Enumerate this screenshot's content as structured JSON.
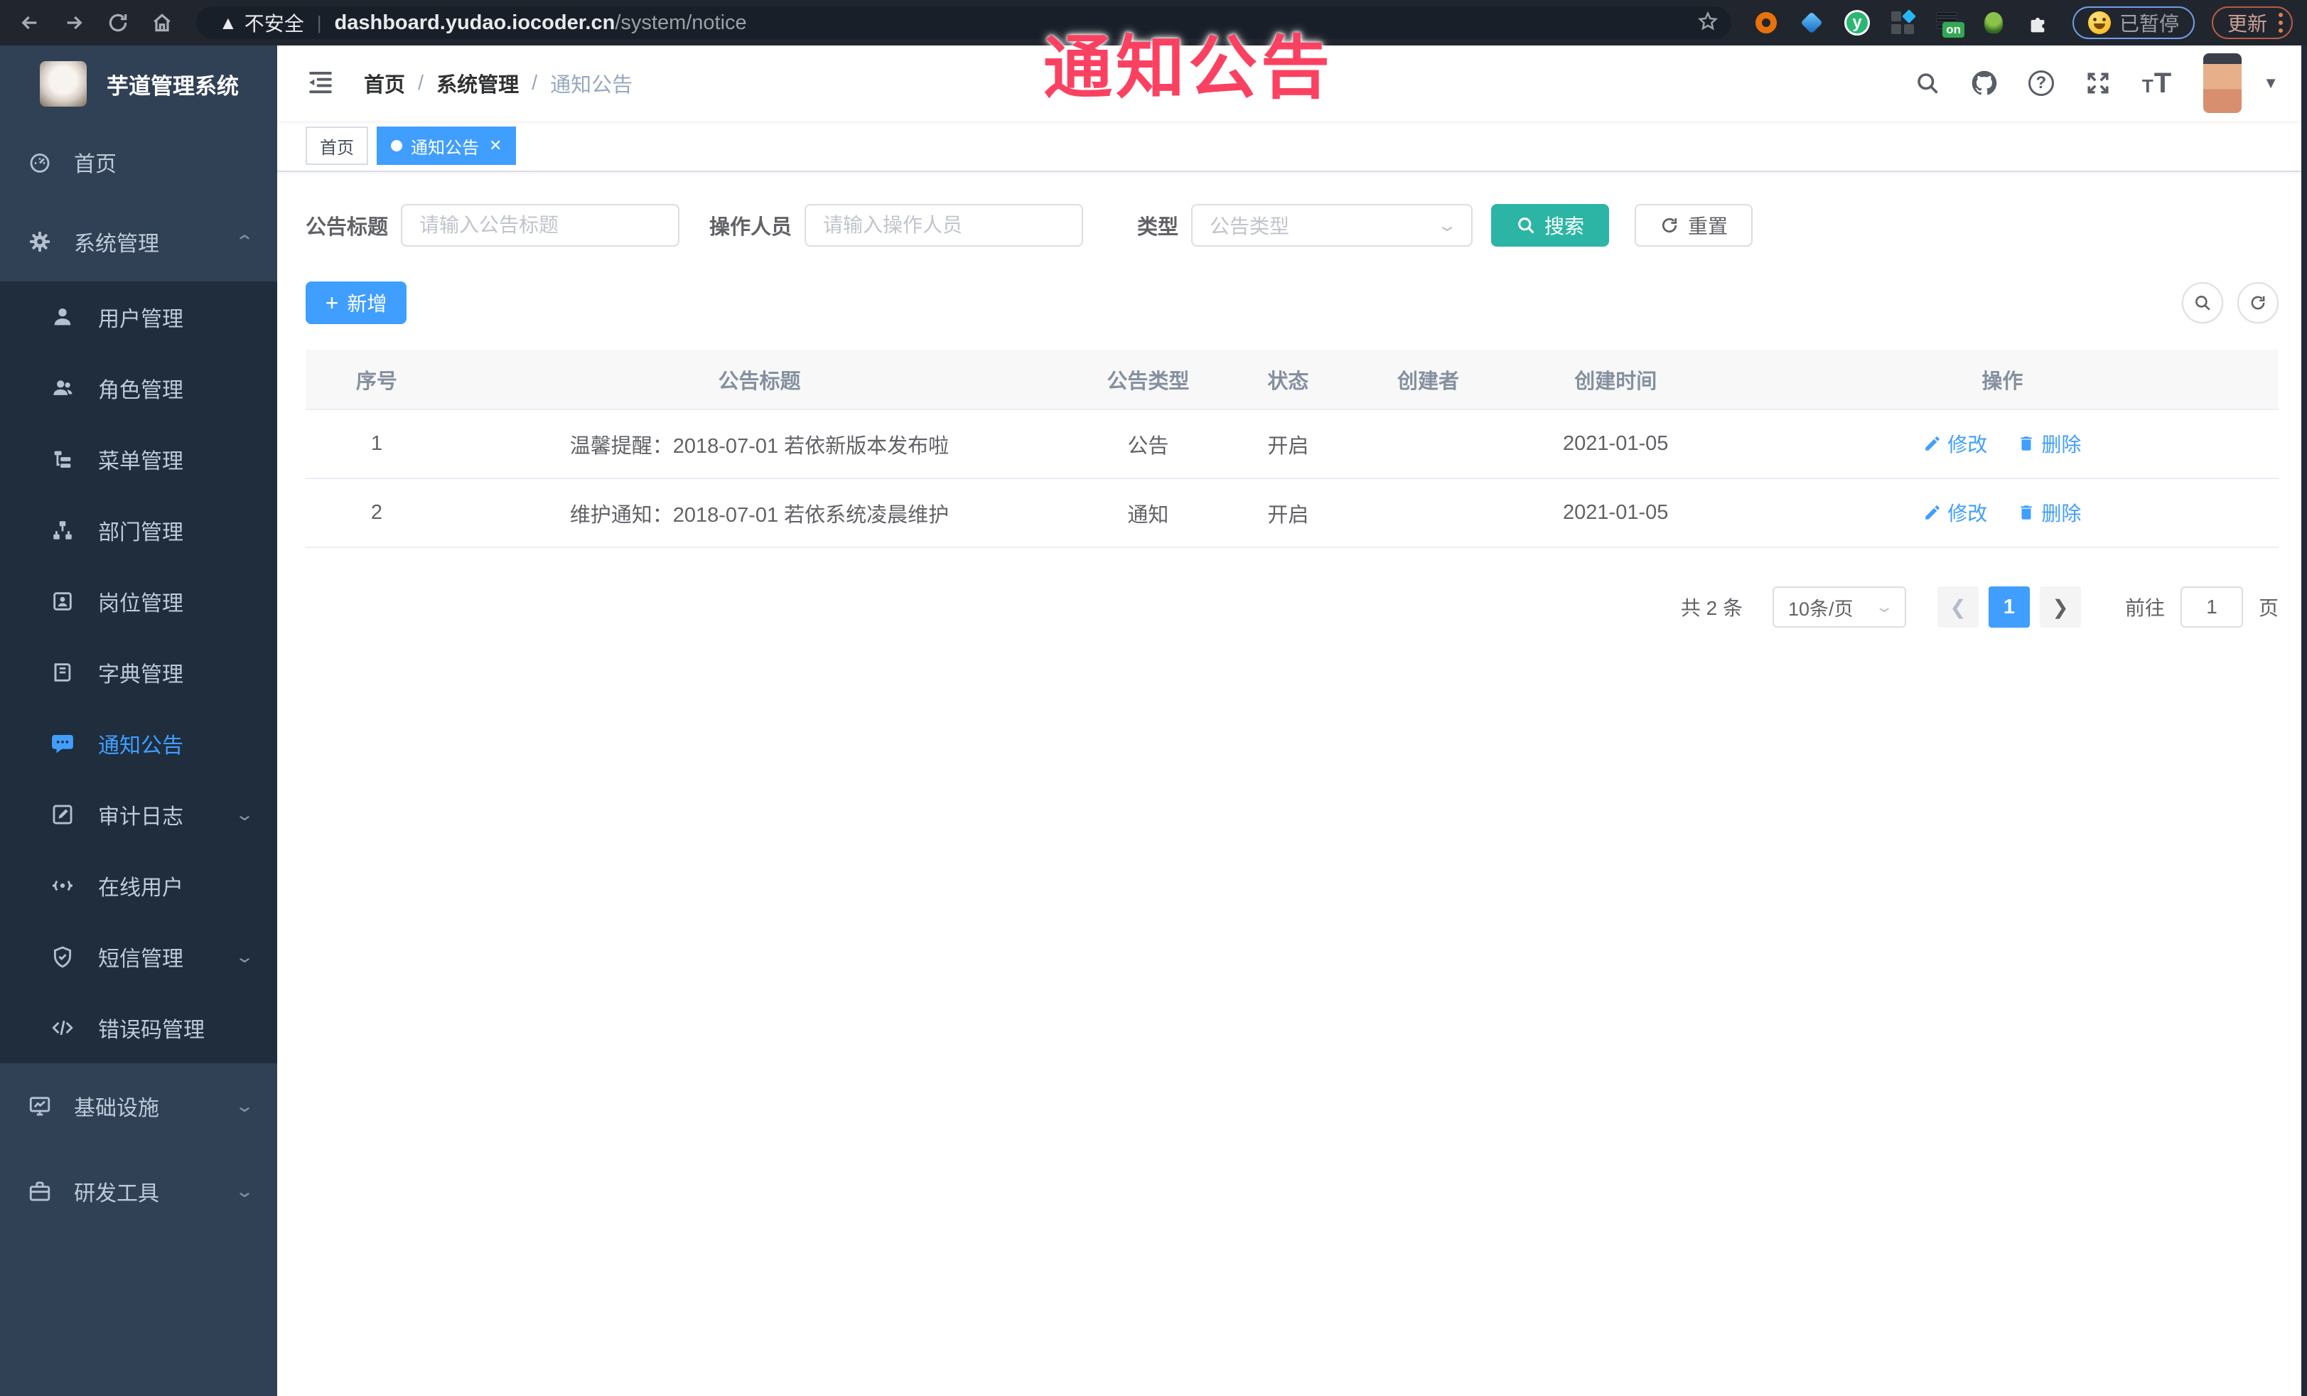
{
  "overlay": {
    "text": "通知公告"
  },
  "browser": {
    "security_label": "不安全",
    "url_host": "dashboard.yudao.iocoder.cn",
    "url_path": "/system/notice",
    "extension_on_badge": "on",
    "paused_label": "已暂停",
    "update_label": "更新"
  },
  "sidebar": {
    "title": "芋道管理系统",
    "menu": [
      "首页",
      "系统管理",
      "用户管理",
      "角色管理",
      "菜单管理",
      "部门管理",
      "岗位管理",
      "字典管理",
      "通知公告",
      "审计日志",
      "在线用户",
      "短信管理",
      "错误码管理",
      "基础设施",
      "研发工具"
    ]
  },
  "navbar": {
    "breadcrumb": [
      "首页",
      "系统管理",
      "通知公告"
    ]
  },
  "tabs": [
    {
      "label": "首页"
    },
    {
      "label": "通知公告"
    }
  ],
  "filters": {
    "title_label": "公告标题",
    "title_placeholder": "请输入公告标题",
    "operator_label": "操作人员",
    "operator_placeholder": "请输入操作人员",
    "type_label": "类型",
    "type_placeholder": "公告类型",
    "search_label": "搜索",
    "reset_label": "重置"
  },
  "toolbar": {
    "add_label": "新增"
  },
  "table": {
    "headers": [
      "序号",
      "公告标题",
      "公告类型",
      "状态",
      "创建者",
      "创建时间",
      "操作"
    ],
    "rows": [
      {
        "no": "1",
        "title": "温馨提醒：2018-07-01 若依新版本发布啦",
        "type": "公告",
        "status": "开启",
        "creator": "",
        "created": "2021-01-05",
        "edit": "修改",
        "delete": "删除"
      },
      {
        "no": "2",
        "title": "维护通知：2018-07-01 若依系统凌晨维护",
        "type": "通知",
        "status": "开启",
        "creator": "",
        "created": "2021-01-05",
        "edit": "修改",
        "delete": "删除"
      }
    ]
  },
  "pagination": {
    "total": "共 2 条",
    "page_size": "10条/页",
    "current": "1",
    "goto_label": "前往",
    "goto_value": "1",
    "unit_label": "页"
  },
  "colors": {
    "accent": "#409eff",
    "search_button": "#2cb5a5",
    "sidebar_bg": "#304156",
    "submenu_bg": "#1f2d3d",
    "overlay_text": "#fb4161"
  }
}
